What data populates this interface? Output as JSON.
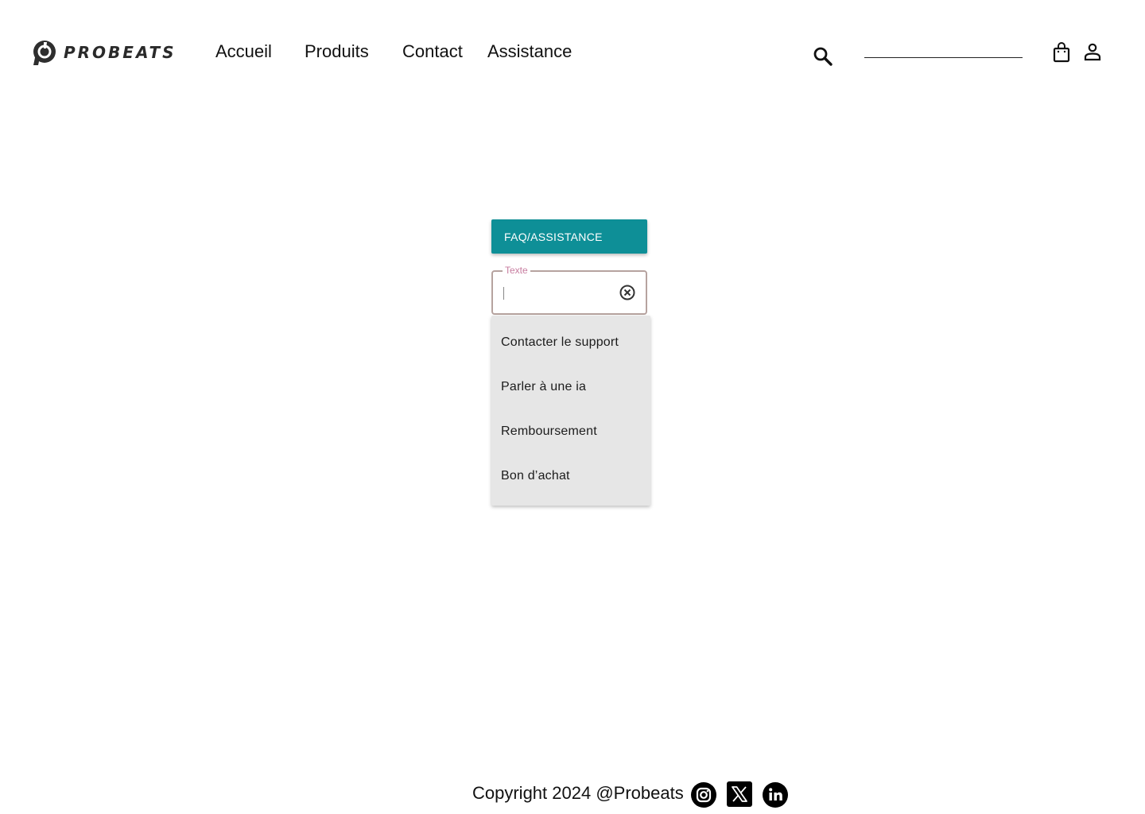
{
  "brand": {
    "name": "PROBEATS"
  },
  "nav": {
    "items": [
      {
        "label": "Accueil"
      },
      {
        "label": "Produits"
      },
      {
        "label": "Contact"
      },
      {
        "label": "Assistance"
      }
    ]
  },
  "header": {
    "search": {
      "value": "",
      "icon": "search-icon"
    },
    "cart": {
      "icon": "shopping-bag-icon"
    },
    "account": {
      "icon": "person-icon"
    }
  },
  "main": {
    "faq_button": {
      "label": "FAQ/ASSISTANCE",
      "color": "#0e8f97"
    },
    "text_field": {
      "label": "Texte",
      "value": "",
      "label_color": "#c77c9f",
      "clear_icon": "clear-circle-icon"
    },
    "dropdown": {
      "items": [
        {
          "label": "Contacter le support"
        },
        {
          "label": "Parler à une ia"
        },
        {
          "label": "Remboursement"
        },
        {
          "label": "Bon d’achat"
        }
      ]
    }
  },
  "footer": {
    "copyright": "Copyright 2024 @Probeats",
    "socials": [
      {
        "icon": "instagram-icon"
      },
      {
        "icon": "x-icon"
      },
      {
        "icon": "linkedin-icon"
      }
    ]
  }
}
